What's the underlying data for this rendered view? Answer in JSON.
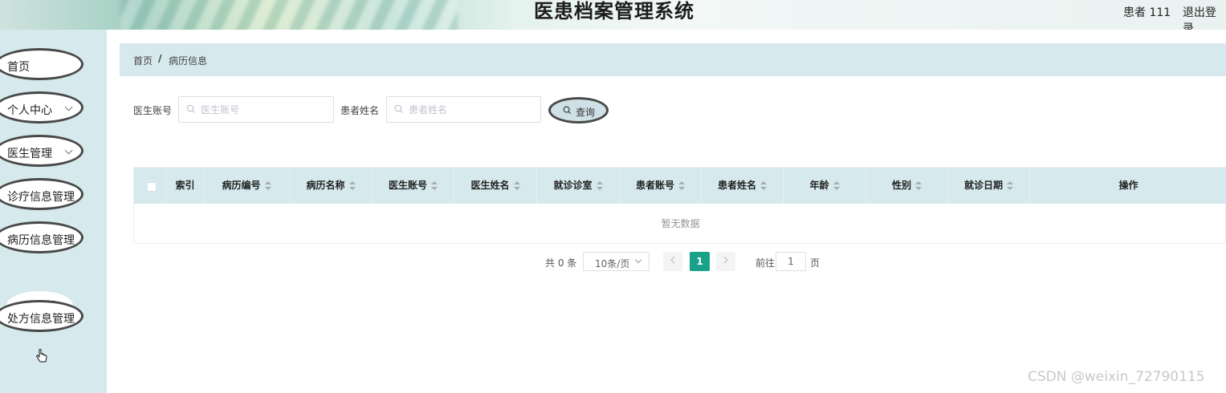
{
  "header": {
    "title": "医患档案管理系统",
    "user": "患者 111",
    "logout": "退出登录"
  },
  "sidebar": {
    "items": [
      {
        "label": "首页",
        "has_arrow": false
      },
      {
        "label": "个人中心",
        "has_arrow": true
      },
      {
        "label": "医生管理",
        "has_arrow": true
      },
      {
        "label": "诊疗信息管理",
        "has_arrow": false
      },
      {
        "label": "病历信息管理",
        "has_arrow": false
      },
      {
        "label": "处方信息管理",
        "has_arrow": false
      }
    ],
    "sub_item": "病历信息"
  },
  "breadcrumb": {
    "home": "首页",
    "separator": "/",
    "current": "病历信息"
  },
  "search": {
    "doctor_label": "医生账号",
    "doctor_placeholder": "医生账号",
    "patient_label": "患者姓名",
    "patient_placeholder": "患者姓名",
    "query_label": "查询"
  },
  "table": {
    "columns": [
      "索引",
      "病历编号",
      "病历名称",
      "医生账号",
      "医生姓名",
      "就诊诊室",
      "患者账号",
      "患者姓名",
      "年龄",
      "性别",
      "就诊日期",
      "操作"
    ],
    "empty_text": "暂无数据"
  },
  "pagination": {
    "total": "共 0 条",
    "page_size": "10条/页",
    "current_page": "1",
    "goto_label": "前往",
    "goto_value": "1",
    "page_unit": "页"
  },
  "watermark": "CSDN @weixin_72790115",
  "colors": {
    "accent": "#1aa18a",
    "sidebar_bg": "#d6e9ec",
    "table_header_bg": "#d6e9ec"
  }
}
